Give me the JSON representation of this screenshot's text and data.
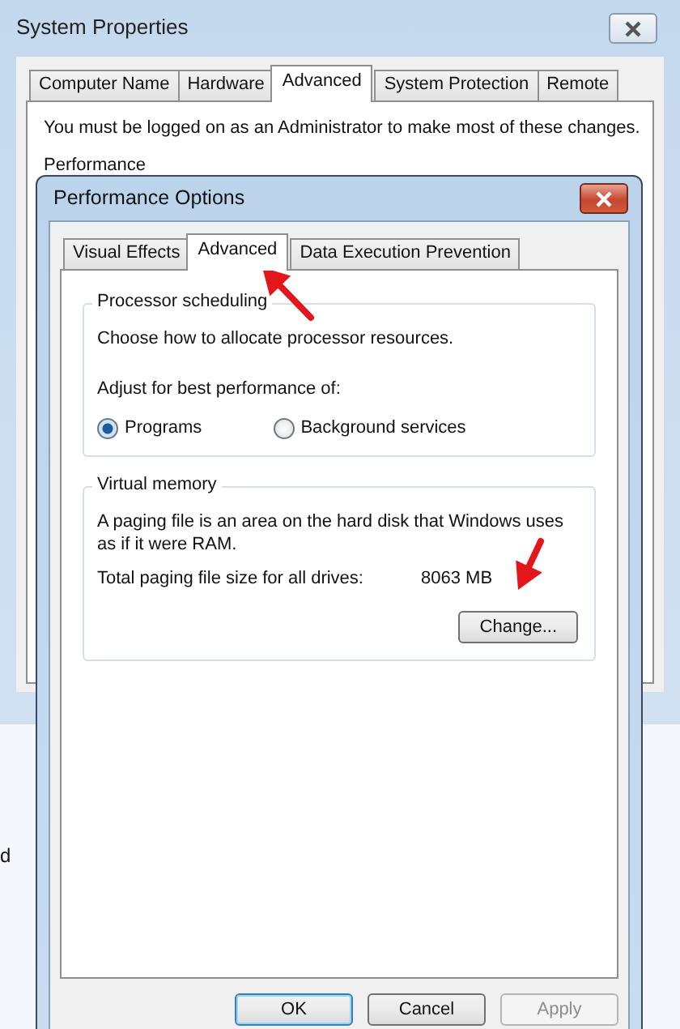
{
  "background_window": {
    "title": "System Properties",
    "tabs": [
      {
        "label": "Computer Name",
        "selected": false
      },
      {
        "label": "Hardware",
        "selected": false
      },
      {
        "label": "Advanced",
        "selected": true
      },
      {
        "label": "System Protection",
        "selected": false
      },
      {
        "label": "Remote",
        "selected": false
      }
    ],
    "notice": "You must be logged on as an Administrator to make most of these changes.",
    "group_label": "Performance",
    "side_text": "d"
  },
  "dialog": {
    "title": "Performance Options",
    "tabs": [
      {
        "label": "Visual Effects",
        "selected": false
      },
      {
        "label": "Advanced",
        "selected": true
      },
      {
        "label": "Data Execution Prevention",
        "selected": false
      }
    ],
    "groups": [
      {
        "kind": "radio",
        "title": "Processor scheduling",
        "description": "Choose how to allocate processor resources.",
        "prompt": "Adjust for best performance of:",
        "options": [
          {
            "label": "Programs",
            "selected": true
          },
          {
            "label": "Background services",
            "selected": false
          }
        ]
      },
      {
        "kind": "info",
        "title": "Virtual memory",
        "description": "A paging file is an area on the hard disk that Windows uses as if it were RAM.",
        "total_label": "Total paging file size for all drives:",
        "total_value": "8063 MB",
        "button": "Change..."
      }
    ],
    "buttons": [
      {
        "label": "OK",
        "default": true,
        "disabled": false
      },
      {
        "label": "Cancel",
        "default": false,
        "disabled": false
      },
      {
        "label": "Apply",
        "default": false,
        "disabled": true
      }
    ]
  }
}
